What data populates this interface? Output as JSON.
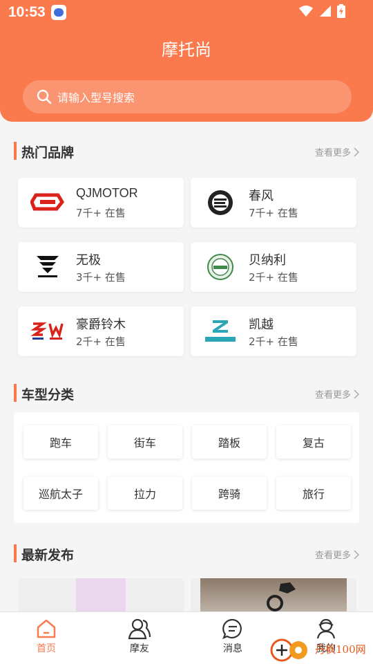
{
  "status_bar": {
    "time": "10:53"
  },
  "app": {
    "title": "摩托尚"
  },
  "search": {
    "placeholder": "请输入型号搜索"
  },
  "hot_brands": {
    "title": "热门品牌",
    "more": "查看更多",
    "items": [
      {
        "name": "QJMOTOR",
        "count": "7千+ 在售",
        "logo": "qjmotor-logo"
      },
      {
        "name": "春风",
        "count": "7千+ 在售",
        "logo": "cfmoto-logo"
      },
      {
        "name": "无极",
        "count": "3千+ 在售",
        "logo": "voge-logo"
      },
      {
        "name": "贝纳利",
        "count": "2千+ 在售",
        "logo": "benelli-logo"
      },
      {
        "name": "豪爵铃木",
        "count": "2千+ 在售",
        "logo": "haojue-suzuki-logo"
      },
      {
        "name": "凯越",
        "count": "2千+ 在售",
        "logo": "kove-logo"
      }
    ]
  },
  "categories": {
    "title": "车型分类",
    "more": "查看更多",
    "items": [
      "跑车",
      "街车",
      "踏板",
      "复古",
      "巡航太子",
      "拉力",
      "跨骑",
      "旅行"
    ]
  },
  "latest": {
    "title": "最新发布",
    "more": "查看更多"
  },
  "tabbar": {
    "items": [
      {
        "label": "首页",
        "icon": "home-icon",
        "active": true
      },
      {
        "label": "摩友",
        "icon": "friends-icon",
        "active": false
      },
      {
        "label": "消息",
        "icon": "message-icon",
        "active": false
      },
      {
        "label": "我的",
        "icon": "profile-icon",
        "active": false
      }
    ]
  },
  "watermark": {
    "text": "丹枫100网"
  },
  "colors": {
    "accent": "#fa7a4d",
    "background": "#f5f5f5"
  }
}
